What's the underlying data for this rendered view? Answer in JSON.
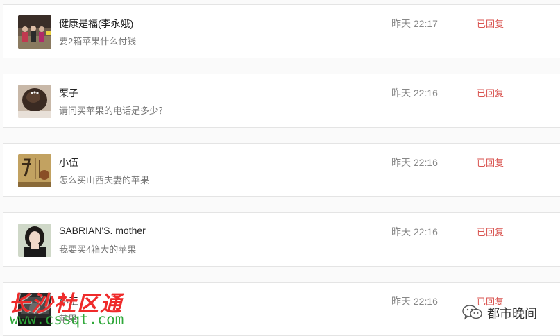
{
  "messages": [
    {
      "name": "健康是福(李永娥)",
      "text": "要2箱苹果什么付钱",
      "time": "昨天 22:17",
      "status": "已回复",
      "avatar": "group-photo-avatar"
    },
    {
      "name": "栗子",
      "text": "请问买苹果的电话是多少？",
      "time": "昨天 22:16",
      "status": "已回复",
      "avatar": "hair-photo-avatar"
    },
    {
      "name": "小伍",
      "text": "怎么买山西夫妻的苹果",
      "time": "昨天 22:16",
      "status": "已回复",
      "avatar": "calligraphy-avatar"
    },
    {
      "name": "SABRIAN'S. mother",
      "text": "我要买4箱大的苹果",
      "time": "昨天 22:16",
      "status": "已回复",
      "avatar": "portrait-avatar"
    },
    {
      "name": "小王",
      "text": "苹果",
      "time": "昨天 22:16",
      "status": "已回复",
      "avatar": "dark-photo-avatar"
    }
  ],
  "watermark": {
    "title": "长沙社区通",
    "url": "www.cssqt.com",
    "brand": "都市晚间"
  },
  "colors": {
    "status": "#d9534f",
    "watermark_red": "#ef2b2b",
    "watermark_green": "#2fa83a"
  }
}
